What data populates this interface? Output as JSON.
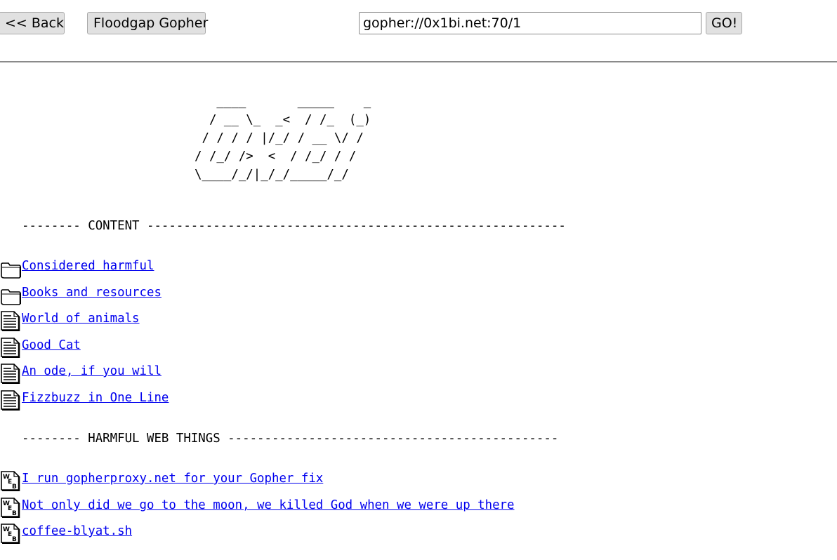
{
  "toolbar": {
    "back_label": "<< Back",
    "home_label": "Floodgap Gopher",
    "address_value": "gopher://0x1bi.net:70/1",
    "go_label": "GO!"
  },
  "banner": {
    "lines": [
      "   ____       _____    _",
      "  / __ \\_  _<  / /_  (_)",
      " / / / / |/_/ / __ \\/ /",
      "/ /_/ />  <  / /_/ / /",
      "\\____/_/|_/_/_____/_/"
    ]
  },
  "sections": [
    {
      "header": "-------- CONTENT ---------------------------------------------------------",
      "items": [
        {
          "type": "folder-icon",
          "label": "Considered harmful"
        },
        {
          "type": "folder-icon",
          "label": "Books and resources"
        },
        {
          "type": "text-file-icon",
          "label": "World of animals"
        },
        {
          "type": "text-file-icon",
          "label": "Good Cat"
        },
        {
          "type": "text-file-icon",
          "label": "An ode, if you will"
        },
        {
          "type": "text-file-icon",
          "label": "Fizzbuzz in One Line"
        }
      ]
    },
    {
      "header": "-------- HARMFUL WEB THINGS ---------------------------------------------",
      "items": [
        {
          "type": "web-link-icon",
          "label": "I run gopherproxy.net for your Gopher fix"
        },
        {
          "type": "web-link-icon",
          "label": "Not only did we go to the moon, we killed God when we were up there"
        },
        {
          "type": "web-link-icon",
          "label": "coffee-blyat.sh"
        }
      ]
    }
  ],
  "colors": {
    "link": "#0000ee",
    "rule": "#8a8a8a",
    "button_bg": "#e1e1e1"
  }
}
